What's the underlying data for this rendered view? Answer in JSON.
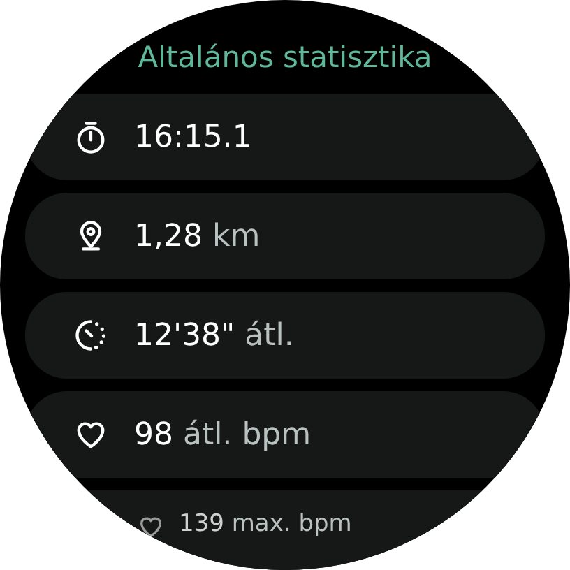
{
  "title": "Altalános statisztika",
  "stats": [
    {
      "kind": "stopwatch",
      "value": "16:15.1"
    },
    {
      "kind": "location",
      "value": "1,28",
      "unit": "km"
    },
    {
      "kind": "pace",
      "value": "12'38\"",
      "unit": "átl."
    },
    {
      "kind": "heart",
      "value": "98",
      "unit": "átl. bpm"
    },
    {
      "kind": "heart",
      "value": "139",
      "unit": "max. bpm"
    }
  ]
}
